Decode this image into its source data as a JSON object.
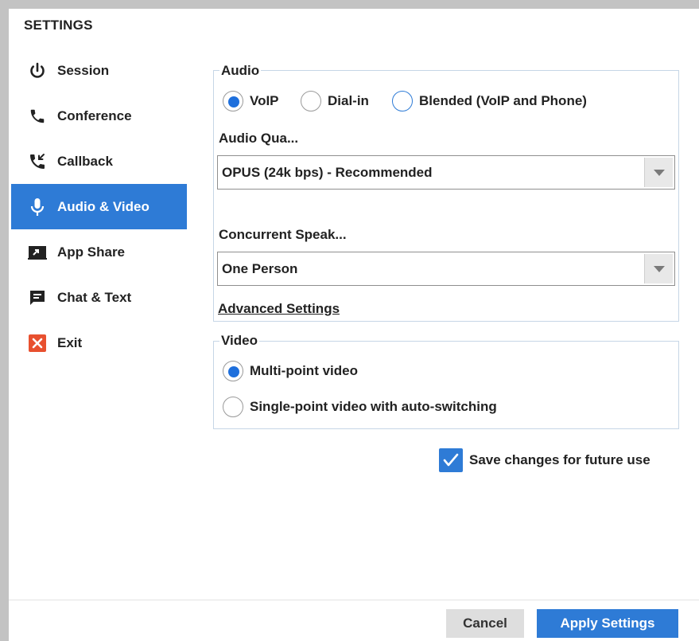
{
  "dialog": {
    "title": "SETTINGS"
  },
  "sidebar": {
    "items": [
      {
        "label": "Session",
        "icon": "power-icon",
        "active": false
      },
      {
        "label": "Conference",
        "icon": "phone-icon",
        "active": false
      },
      {
        "label": "Callback",
        "icon": "phone-callback-icon",
        "active": false
      },
      {
        "label": "Audio & Video",
        "icon": "microphone-icon",
        "active": true
      },
      {
        "label": "App Share",
        "icon": "screen-share-icon",
        "active": false
      },
      {
        "label": "Chat & Text",
        "icon": "chat-icon",
        "active": false
      },
      {
        "label": "Exit",
        "icon": "close-icon",
        "active": false
      }
    ]
  },
  "audio": {
    "legend": "Audio",
    "options": [
      {
        "label": "VoIP",
        "selected": true
      },
      {
        "label": "Dial-in",
        "selected": false
      },
      {
        "label": "Blended (VoIP and Phone)",
        "selected": false
      }
    ],
    "quality_label": "Audio Qua...",
    "quality_value": "OPUS (24k bps) - Recommended",
    "speak_label": "Concurrent Speak...",
    "speak_value": "One Person",
    "advanced_link": "Advanced Settings"
  },
  "video": {
    "legend": "Video",
    "options": [
      {
        "label": "Multi-point video",
        "selected": true
      },
      {
        "label": "Single-point video with auto-switching",
        "selected": false
      }
    ]
  },
  "save_changes": {
    "label": "Save changes for future use",
    "checked": true
  },
  "footer": {
    "cancel_label": "Cancel",
    "apply_label": "Apply Settings"
  },
  "colors": {
    "accent": "#2e7bd6",
    "exit_icon": "#e8502f",
    "frame": "#c3c3c3"
  }
}
